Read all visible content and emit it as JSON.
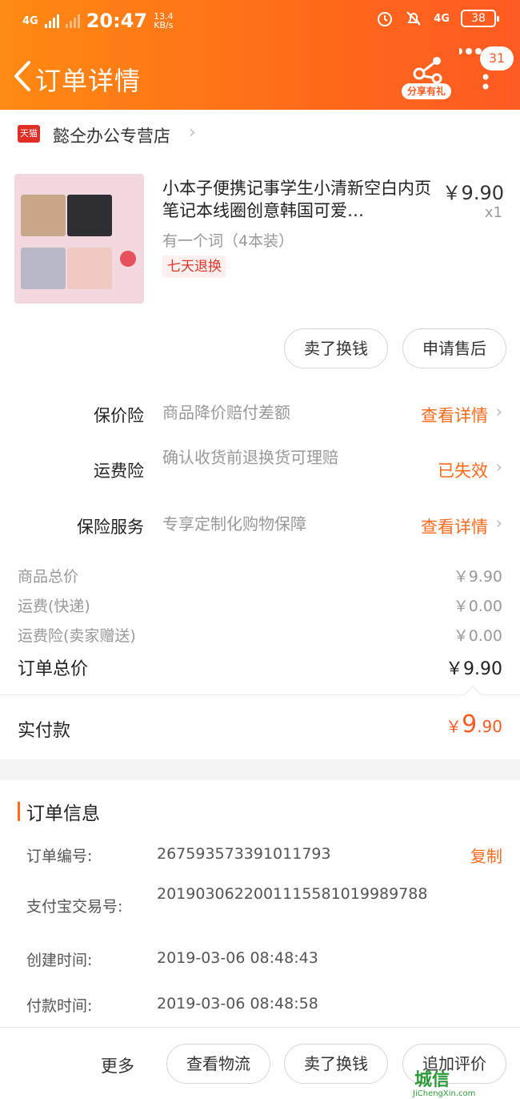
{
  "status_bar": {
    "network_left": "4G",
    "time": "20:47",
    "speed_value": "13.4",
    "speed_unit": "KB/s",
    "network_right": "4G",
    "battery": "38"
  },
  "header": {
    "title": "订单详情",
    "share_label": "分享有礼",
    "message_count": "31"
  },
  "store": {
    "badge": "天猫",
    "name": "懿仝办公专营店"
  },
  "product": {
    "title": "小本子便携记事学生小清新空白内页笔记本线圈创意韩国可爱…",
    "price": "￥9.90",
    "quantity": "x1",
    "spec": "有一个词（4本装）",
    "tag": "七天退换"
  },
  "actions": {
    "sell": "卖了换钱",
    "after_sale": "申请售后"
  },
  "insurance": [
    {
      "label": "保价险",
      "desc": "商品降价赔付差额",
      "action": "查看详情"
    },
    {
      "label": "运费险",
      "desc": "确认收货前退换货可理赔",
      "action": "已失效"
    },
    {
      "label": "保险服务",
      "desc": "专享定制化购物保障",
      "action": "查看详情"
    }
  ],
  "fees": {
    "goods_total_label": "商品总价",
    "goods_total": "￥9.90",
    "shipping_label": "运费(快递)",
    "shipping": "￥0.00",
    "shipping_ins_label": "运费险(卖家赠送)",
    "shipping_ins": "￥0.00",
    "order_total_label": "订单总价",
    "order_total": "￥9.90",
    "paid_label": "实付款",
    "paid_currency": "￥",
    "paid_int": "9",
    "paid_dec": ".90"
  },
  "order_info": {
    "title": "订单信息",
    "order_no_label": "订单编号:",
    "order_no": "267593573391011793",
    "copy": "复制",
    "alipay_label": "支付宝交易号:",
    "alipay_no": "2019030622001115581019989788",
    "created_label": "创建时间:",
    "created": "2019-03-06 08:48:43",
    "paid_label": "付款时间:",
    "paid": "2019-03-06 08:48:58"
  },
  "bottom_bar": {
    "more": "更多",
    "logistics": "查看物流",
    "sell": "卖了换钱",
    "review": "追加评价"
  },
  "watermark": {
    "main": "城信",
    "sub": "JiChengXin.com"
  },
  "colors": {
    "accent": "#ff6a1a",
    "tmall": "#e02e24"
  }
}
